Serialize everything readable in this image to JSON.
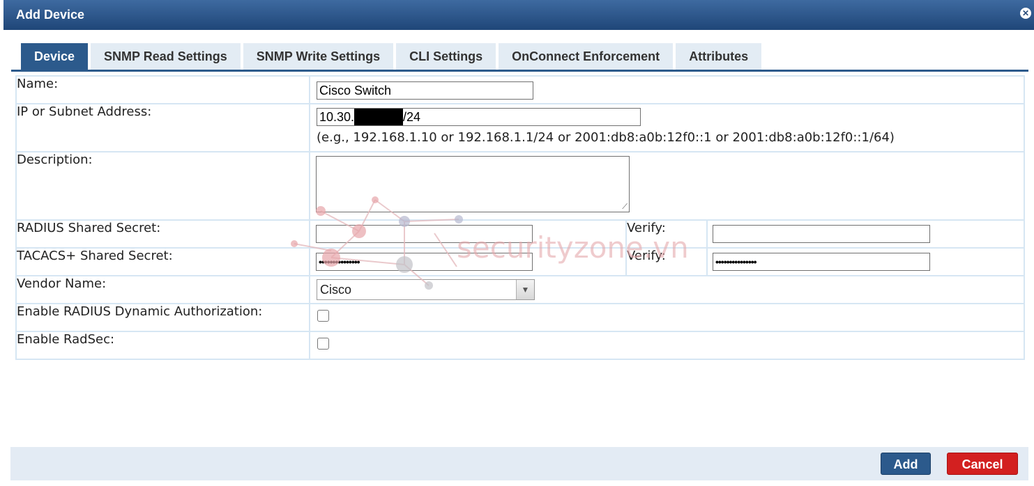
{
  "dialog": {
    "title": "Add Device",
    "close_icon": "close-icon"
  },
  "tabs": [
    {
      "label": "Device",
      "active": true
    },
    {
      "label": "SNMP Read Settings"
    },
    {
      "label": "SNMP Write Settings"
    },
    {
      "label": "CLI Settings"
    },
    {
      "label": "OnConnect Enforcement"
    },
    {
      "label": "Attributes"
    }
  ],
  "form": {
    "name": {
      "label": "Name:",
      "value": "Cisco Switch"
    },
    "ip": {
      "label": "IP or Subnet Address:",
      "value_prefix": "10.30.",
      "value_suffix": "/24",
      "hint": "(e.g., 192.168.1.10 or 192.168.1.1/24 or 2001:db8:a0b:12f0::1 or 2001:db8:a0b:12f0::1/64)"
    },
    "description": {
      "label": "Description:",
      "value": ""
    },
    "radius_secret": {
      "label": "RADIUS Shared Secret:",
      "value": "",
      "verify_label": "Verify:",
      "verify_value": ""
    },
    "tacacs_secret": {
      "label": "TACACS+ Shared Secret:",
      "value": "•••••••••••••••",
      "verify_label": "Verify:",
      "verify_value": "•••••••••••••••"
    },
    "vendor": {
      "label": "Vendor Name:",
      "value": "Cisco"
    },
    "radius_dyn_auth": {
      "label": "Enable RADIUS Dynamic Authorization:",
      "checked": false
    },
    "radsec": {
      "label": "Enable RadSec:",
      "checked": false
    }
  },
  "buttons": {
    "add": "Add",
    "cancel": "Cancel"
  },
  "watermark": {
    "text": "securityzone.vn"
  },
  "colors": {
    "header": "#2c5a8c",
    "cancel": "#d32020",
    "border": "#d6e6f3"
  }
}
